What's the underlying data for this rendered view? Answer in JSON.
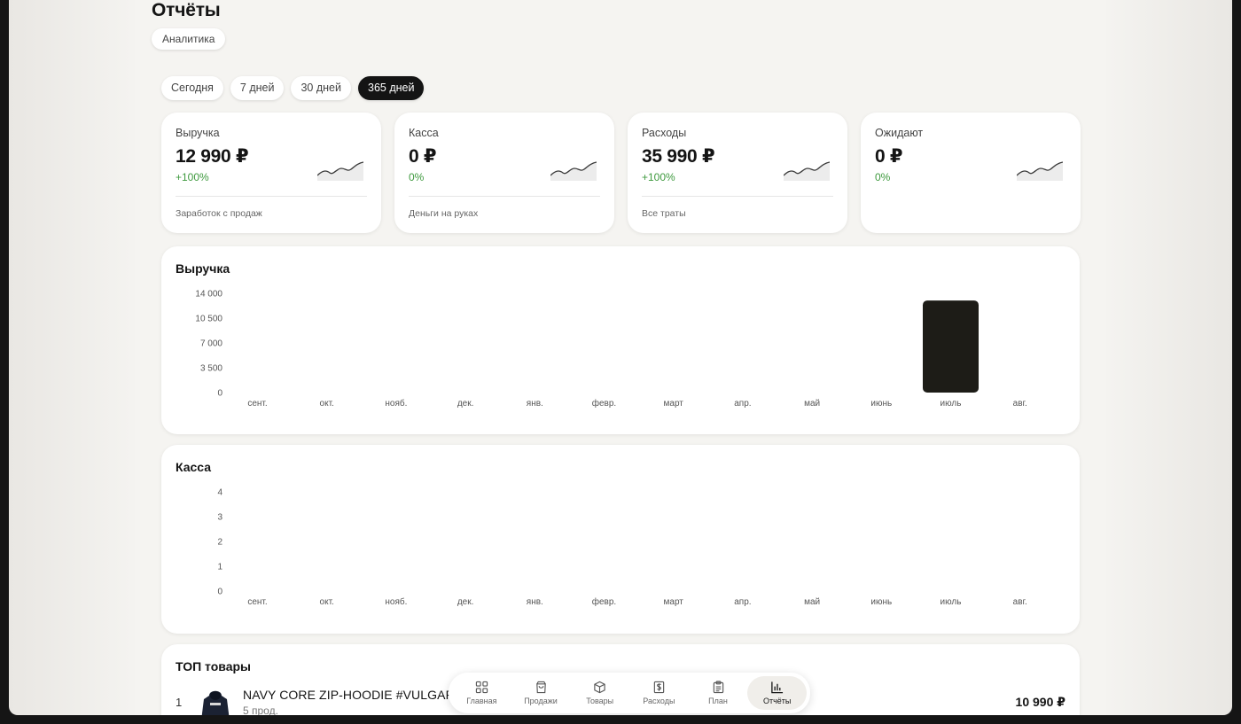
{
  "page": {
    "title": "Отчёты",
    "breadcrumb": "Аналитика"
  },
  "periods": [
    {
      "label": "Сегодня",
      "active": false
    },
    {
      "label": "7 дней",
      "active": false
    },
    {
      "label": "30 дней",
      "active": false
    },
    {
      "label": "365 дней",
      "active": true
    }
  ],
  "cards": [
    {
      "title": "Выручка",
      "value": "12 990 ₽",
      "delta": "+100%",
      "note": "Заработок с продаж"
    },
    {
      "title": "Касса",
      "value": "0 ₽",
      "delta": "0%",
      "note": "Деньги на руках"
    },
    {
      "title": "Расходы",
      "value": "35 990 ₽",
      "delta": "+100%",
      "note": "Все траты"
    },
    {
      "title": "Ожидают",
      "value": "0 ₽",
      "delta": "0%",
      "note": ""
    }
  ],
  "colors": {
    "accent": "#141414",
    "positive": "#3f9a3f",
    "bar": "#1d1c17"
  },
  "chart_data": [
    {
      "type": "bar",
      "title": "Выручка",
      "categories": [
        "сент.",
        "окт.",
        "нояб.",
        "дек.",
        "янв.",
        "февр.",
        "март",
        "апр.",
        "май",
        "июнь",
        "июль",
        "авг."
      ],
      "values": [
        0,
        0,
        0,
        0,
        0,
        0,
        0,
        0,
        0,
        0,
        12990,
        0
      ],
      "yticks": [
        "0",
        "3 500",
        "7 000",
        "10 500",
        "14 000"
      ],
      "ylim": [
        0,
        14000
      ],
      "grid": false
    },
    {
      "type": "bar",
      "title": "Касса",
      "categories": [
        "сент.",
        "окт.",
        "нояб.",
        "дек.",
        "янв.",
        "февр.",
        "март",
        "апр.",
        "май",
        "июнь",
        "июль",
        "авг."
      ],
      "values": [
        0,
        0,
        0,
        0,
        0,
        0,
        0,
        0,
        0,
        0,
        0,
        0
      ],
      "yticks": [
        "0",
        "1",
        "2",
        "3",
        "4"
      ],
      "ylim": [
        0,
        4
      ],
      "grid": false
    }
  ],
  "top": {
    "title": "ТОП товары",
    "items": [
      {
        "rank": "1",
        "name": "NAVY CORE ZIP-HOODIE #VULGAR",
        "sub": "5 прод.",
        "price": "10 990 ₽"
      }
    ]
  },
  "nav": [
    {
      "label": "Главная",
      "icon": "grid-icon",
      "active": false
    },
    {
      "label": "Продажи",
      "icon": "shopping-bag-icon",
      "active": false
    },
    {
      "label": "Товары",
      "icon": "box-icon",
      "active": false
    },
    {
      "label": "Расходы",
      "icon": "dollar-receipt-icon",
      "active": false
    },
    {
      "label": "План",
      "icon": "clipboard-icon",
      "active": false
    },
    {
      "label": "Отчёты",
      "icon": "bar-chart-icon",
      "active": true
    }
  ]
}
